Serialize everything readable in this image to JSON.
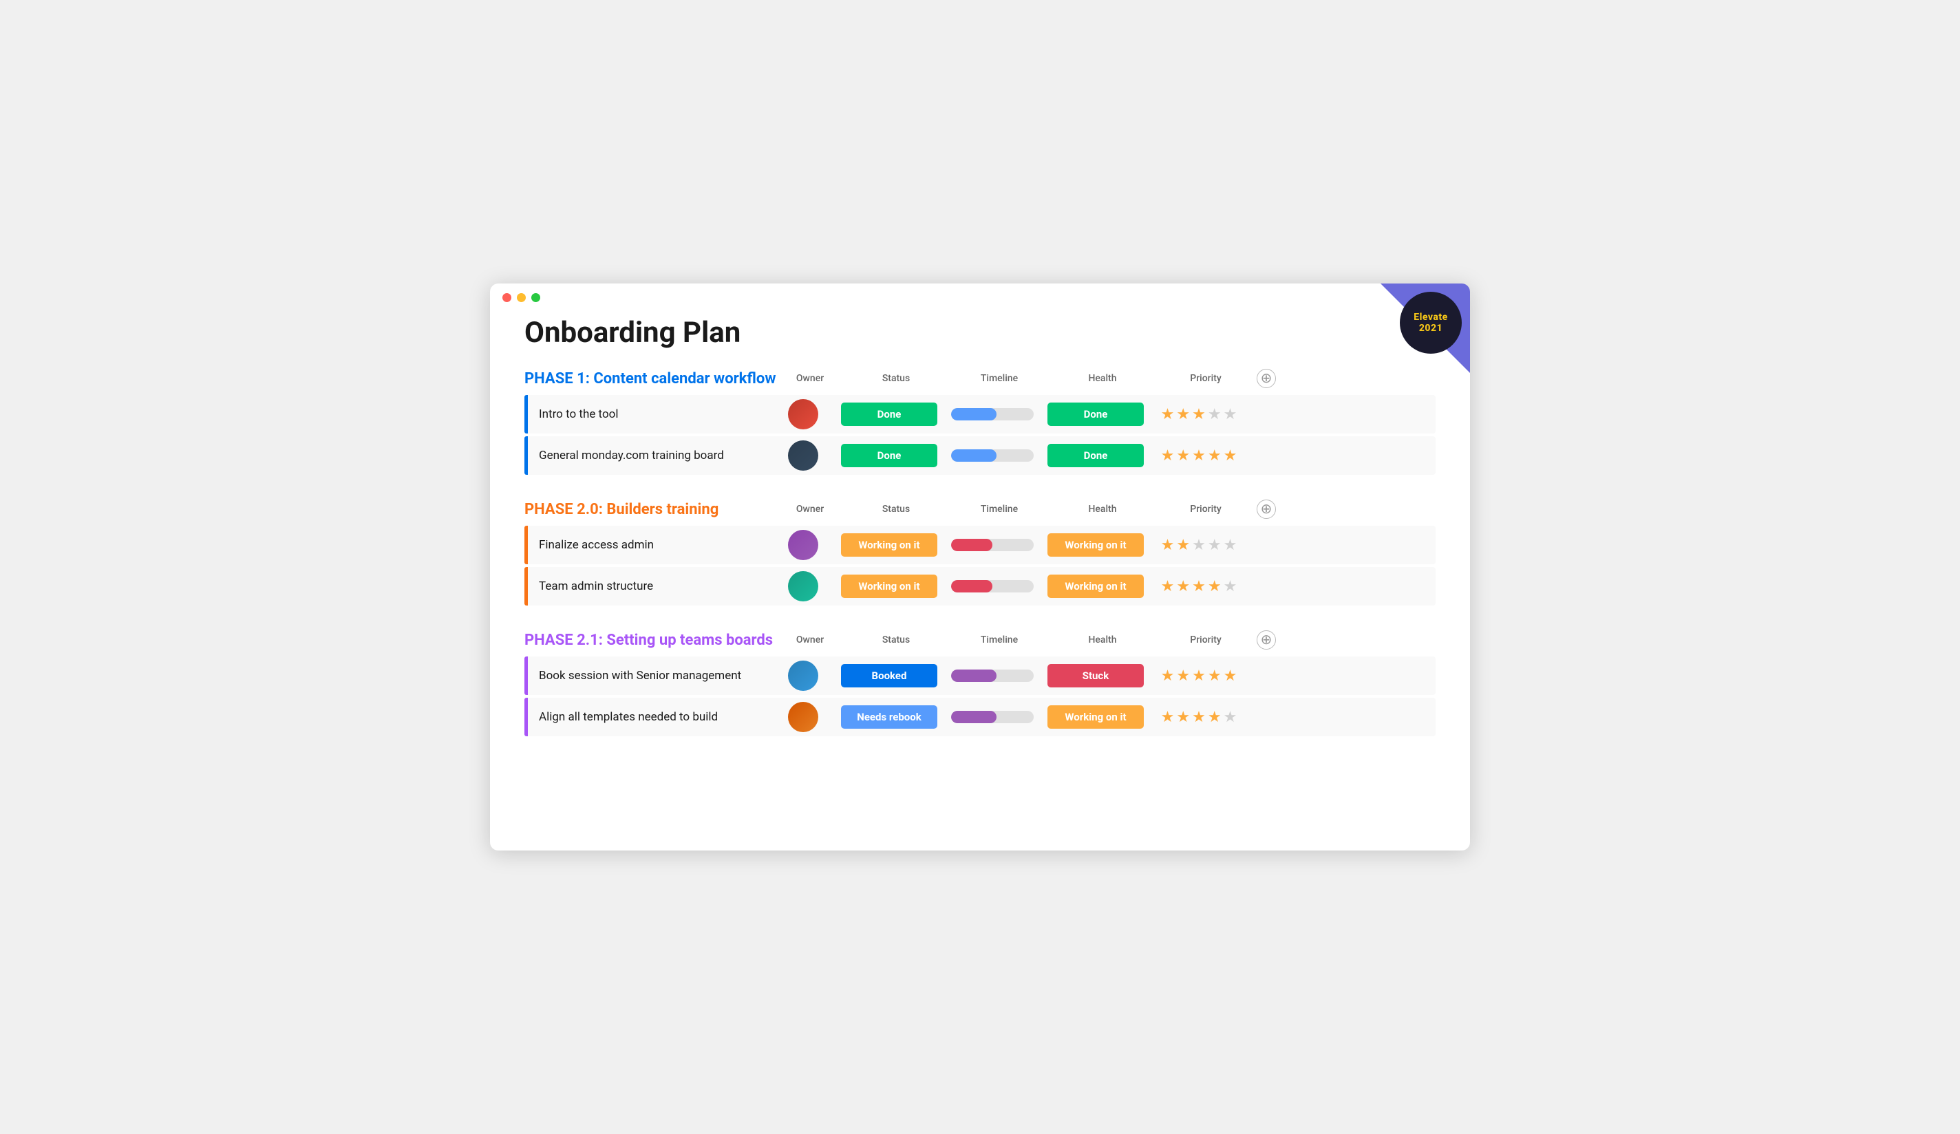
{
  "window": {
    "title": "Onboarding Plan"
  },
  "badge": {
    "line1": "Elevate",
    "line2": "2021"
  },
  "page": {
    "title": "Onboarding Plan"
  },
  "phases": [
    {
      "id": "phase1",
      "title": "PHASE 1: Content calendar workflow",
      "color": "blue",
      "accent": "accent-blue",
      "columns": [
        "Owner",
        "Status",
        "Timeline",
        "Health",
        "Priority"
      ],
      "tasks": [
        {
          "name": "Intro to the tool",
          "avatar_class": "av1",
          "avatar_emoji": "👤",
          "status_label": "Done",
          "status_class": "status-green",
          "timeline_class": "tl-blue",
          "health_label": "Done",
          "health_class": "status-green",
          "stars": 3,
          "total_stars": 5
        },
        {
          "name": "General monday.com training board",
          "avatar_class": "av2",
          "avatar_emoji": "👤",
          "status_label": "Done",
          "status_class": "status-green",
          "timeline_class": "tl-blue",
          "health_label": "Done",
          "health_class": "status-green",
          "stars": 5,
          "total_stars": 5
        }
      ]
    },
    {
      "id": "phase2",
      "title": "PHASE 2.0: Builders training",
      "color": "orange",
      "accent": "accent-orange",
      "columns": [
        "Owner",
        "Status",
        "Timeline",
        "Health",
        "Priority"
      ],
      "tasks": [
        {
          "name": "Finalize access admin",
          "avatar_class": "av3",
          "avatar_emoji": "👤",
          "status_label": "Working on it",
          "status_class": "status-orange",
          "timeline_class": "tl-orange",
          "health_label": "Working on it",
          "health_class": "status-orange",
          "stars": 2,
          "total_stars": 5
        },
        {
          "name": "Team admin structure",
          "avatar_class": "av4",
          "avatar_emoji": "👤",
          "status_label": "Working on it",
          "status_class": "status-orange",
          "timeline_class": "tl-orange",
          "health_label": "Working on it",
          "health_class": "status-orange",
          "stars": 4,
          "total_stars": 5
        }
      ]
    },
    {
      "id": "phase21",
      "title": "PHASE 2.1: Setting up teams boards",
      "color": "purple",
      "accent": "accent-purple",
      "columns": [
        "Owner",
        "Status",
        "Timeline",
        "Health",
        "Priority"
      ],
      "tasks": [
        {
          "name": "Book session with Senior management",
          "avatar_class": "av5",
          "avatar_emoji": "👤",
          "status_label": "Booked",
          "status_class": "status-blue",
          "timeline_class": "tl-purple",
          "health_label": "Stuck",
          "health_class": "status-pink",
          "stars": 5,
          "total_stars": 5
        },
        {
          "name": "Align all templates needed to build",
          "avatar_class": "av6",
          "avatar_emoji": "👤",
          "status_label": "Needs rebook",
          "status_class": "status-light-blue",
          "timeline_class": "tl-purple",
          "health_label": "Working on it",
          "health_class": "status-orange",
          "stars": 4,
          "total_stars": 5
        }
      ]
    }
  ],
  "add_button_label": "+"
}
